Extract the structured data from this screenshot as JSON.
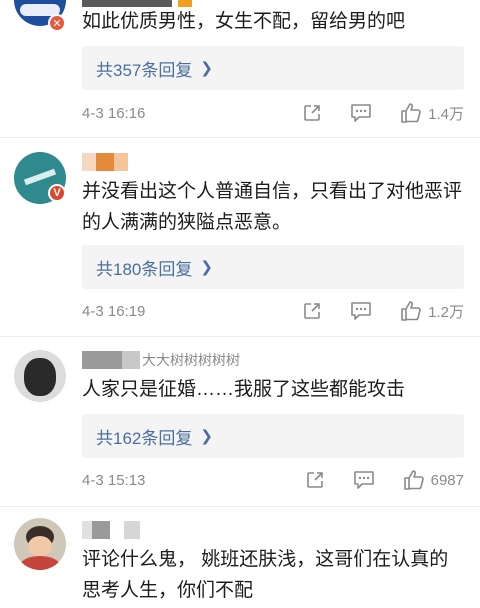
{
  "comments": [
    {
      "text": "如此优质男性，女生不配，留给男的吧",
      "replies": "共357条回复",
      "time": "4-3 16:16",
      "likes": "1.4万",
      "badge": "✕"
    },
    {
      "text": "并没看出这个人普通自信，只看出了对他恶评的人满满的狭隘点恶意。",
      "replies": "共180条回复",
      "time": "4-3 16:19",
      "likes": "1.2万",
      "badge": "V"
    },
    {
      "text": "人家只是征婚……我服了这些都能攻击",
      "replies": "共162条回复",
      "time": "4-3 15:13",
      "likes": "6987",
      "name_visible": "大大树树树树树"
    },
    {
      "text": "评论什么鬼， 姚班还肤浅，这哥们在认真的思考人生，你们不配"
    }
  ],
  "icons": {
    "share": "share-icon",
    "comment": "comment-icon",
    "like": "thumbs-up-icon",
    "chevron": "chevron-right-icon"
  },
  "colors": {
    "reply_link": "#4a6fa0",
    "meta_gray": "#8a8a8a",
    "reply_bg": "#f4f4f4",
    "badge_orange": "#e8a02b"
  }
}
